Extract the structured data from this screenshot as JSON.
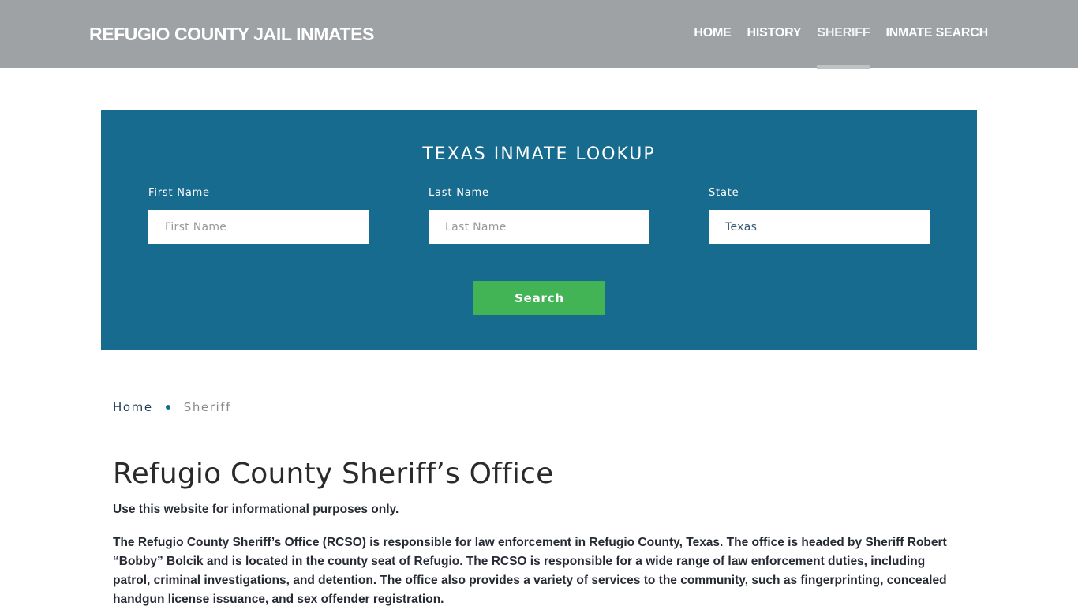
{
  "header": {
    "brand": "REFUGIO COUNTY JAIL INMATES",
    "nav": [
      {
        "label": "HOME",
        "active": false
      },
      {
        "label": "HISTORY",
        "active": false
      },
      {
        "label": "SHERIFF",
        "active": true
      },
      {
        "label": "INMATE SEARCH",
        "active": false
      }
    ]
  },
  "lookup": {
    "title": "TEXAS INMATE LOOKUP",
    "fields": [
      {
        "label": "First Name",
        "placeholder": "First Name",
        "value": ""
      },
      {
        "label": "Last Name",
        "placeholder": "Last Name",
        "value": ""
      },
      {
        "label": "State",
        "placeholder": "",
        "value": "Texas"
      }
    ],
    "button_label": "Search"
  },
  "breadcrumb": {
    "home": "Home",
    "current": "Sheriff"
  },
  "content": {
    "title": "Refugio County Sheriff’s Office",
    "disclaimer": "Use this website for informational purposes only.",
    "paragraph": "The Refugio County Sheriff’s Office (RCSO) is responsible for law enforcement in Refugio County, Texas. The office is headed by Sheriff Robert “Bobby” Bolcik and is located in the county seat of Refugio. The RCSO is responsible for a wide range of law enforcement duties, including patrol, criminal investigations, and detention. The office also provides a variety of services to the community, such as fingerprinting, concealed handgun license issuance, and sex offender registration."
  },
  "colors": {
    "header_bg": "#9ea2a5",
    "lookup_bg": "#176b8e",
    "button_bg": "#43b456"
  }
}
